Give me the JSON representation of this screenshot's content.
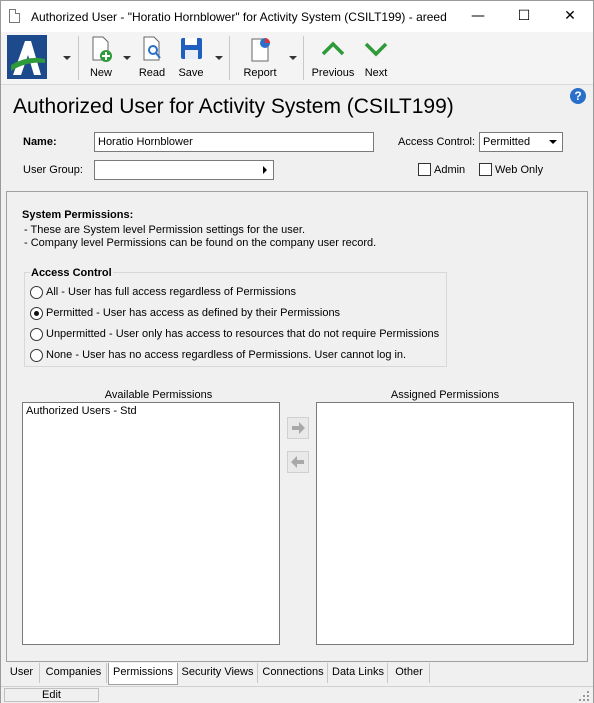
{
  "window": {
    "title": "Authorized User - \"Horatio Hornblower\" for Activity System (CSILT199) - areed",
    "minimize": "—",
    "maximize": "☐",
    "close": "✕"
  },
  "toolbar": {
    "new_label": "New",
    "read_label": "Read",
    "save_label": "Save",
    "report_label": "Report",
    "previous_label": "Previous",
    "next_label": "Next"
  },
  "header": {
    "title": "Authorized User for Activity System (CSILT199)",
    "help": "?"
  },
  "form": {
    "name_label": "Name:",
    "name_value": "Horatio Hornblower",
    "access_control_label": "Access Control:",
    "access_control_value": "Permitted",
    "user_group_label": "User Group:",
    "user_group_value": "",
    "admin_label": "Admin",
    "web_only_label": "Web Only"
  },
  "permissions": {
    "title": "System Permissions:",
    "note1": "- These are System level Permission settings for the user.",
    "note2": "- Company level Permissions can be found on the company user record.",
    "access_group_label": "Access Control",
    "options": [
      {
        "label": "All - User has full access regardless of Permissions",
        "selected": false
      },
      {
        "label": "Permitted - User has access as defined by their Permissions",
        "selected": true
      },
      {
        "label": "Unpermitted - User only has access to resources that do not require Permissions",
        "selected": false
      },
      {
        "label": "None - User has no access regardless of Permissions. User cannot log in.",
        "selected": false
      }
    ],
    "available_label": "Available Permissions",
    "assigned_label": "Assigned Permissions",
    "available_items": [
      "Authorized Users - Std"
    ],
    "assigned_items": []
  },
  "tabs": [
    "User",
    "Companies",
    "Permissions",
    "Security Views",
    "Connections",
    "Data Links",
    "Other"
  ],
  "active_tab": "Permissions",
  "status": {
    "mode": "Edit"
  },
  "colors": {
    "accent_green": "#2e9a3a",
    "logo_blue": "#1d4a8c",
    "help_blue": "#2a6fc9"
  }
}
